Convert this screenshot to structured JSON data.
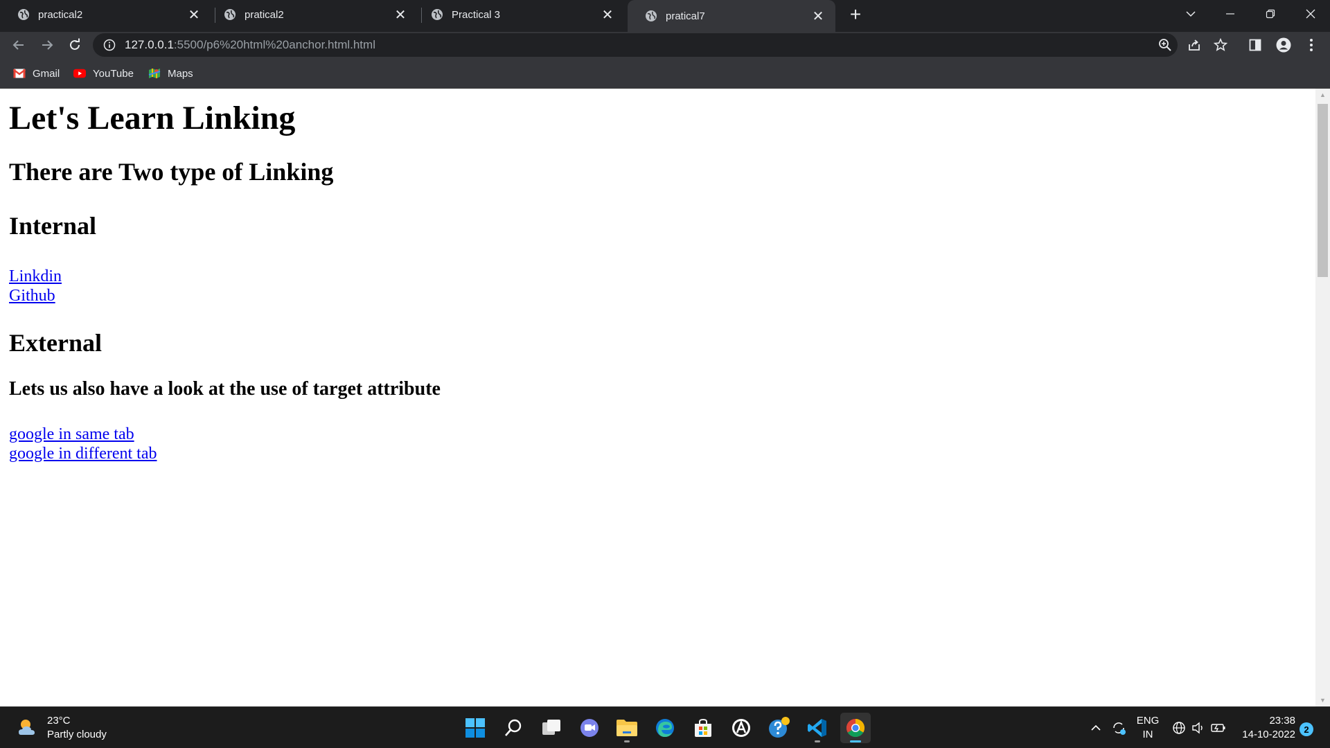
{
  "browser": {
    "tabs": [
      {
        "title": "practical2",
        "active": false
      },
      {
        "title": "pratical2",
        "active": false
      },
      {
        "title": "Practical 3",
        "active": false
      },
      {
        "title": "pratical7",
        "active": true
      }
    ],
    "url_host": "127.0.0.1",
    "url_path": ":5500/p6%20html%20anchor.html.html",
    "bookmarks": [
      {
        "label": "Gmail",
        "icon": "gmail-icon"
      },
      {
        "label": "YouTube",
        "icon": "youtube-icon"
      },
      {
        "label": "Maps",
        "icon": "maps-icon"
      }
    ]
  },
  "page": {
    "h1": "Let's Learn Linking",
    "h2_intro": "There are Two type of Linking",
    "h2_internal": "Internal",
    "internal_links": [
      "Linkdin",
      "Github"
    ],
    "h2_external": "External",
    "h3_target": "Lets us also have a look at the use of target attribute",
    "external_links": [
      "google in same tab",
      "google in different tab"
    ]
  },
  "taskbar": {
    "weather_temp": "23°C",
    "weather_desc": "Partly cloudy",
    "lang_top": "ENG",
    "lang_bottom": "IN",
    "time": "23:38",
    "date": "14-10-2022",
    "notifications": "2"
  },
  "colors": {
    "tabstrip": "#202124",
    "toolbar": "#35363a",
    "link": "#0000ee",
    "taskbar": "#1c1c1c",
    "accent": "#4cc2ff"
  }
}
